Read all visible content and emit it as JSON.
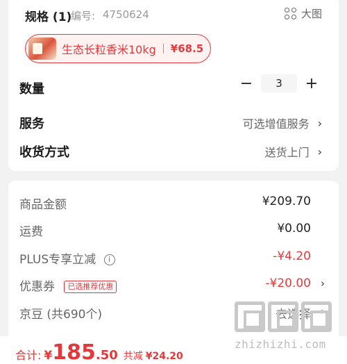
{
  "spec": {
    "title": "规格 (1)",
    "code_label": "编号:",
    "code_value": "4750624",
    "big_pic_label": "大图",
    "chip_name": "生态长粒香米10kg",
    "chip_price": "¥68.5"
  },
  "rows": {
    "quantity_label": "数量",
    "quantity_value": "3",
    "minus": "−",
    "plus": "+",
    "service_label": "服务",
    "service_value": "可选增值服务",
    "delivery_label": "收货方式",
    "delivery_value": "送货上门",
    "chevron": "›"
  },
  "price": {
    "goods_label": "商品金额",
    "goods_value": "¥209.70",
    "shipping_label": "运费",
    "shipping_value": "¥0.00",
    "plus_label": "PLUS专享立减",
    "plus_value": "-¥4.20",
    "coupon_label": "优惠券",
    "coupon_badge": "已选推荐优惠",
    "coupon_value": "-¥20.00",
    "jd_label": "京豆 (共690个)",
    "jd_value": "去选择"
  },
  "footer": {
    "total_label": "合计:",
    "yen": "¥",
    "total_int": "185",
    "total_dec": ".50",
    "saved_label": "共减",
    "saved_value": "¥24.20"
  },
  "watermark": {
    "text": "zhizhizhi.com"
  },
  "colors": {
    "accent": "#e4393c",
    "background": "#f2f2f2",
    "card": "#ffffff"
  },
  "icons": {
    "big_pic": "grid-four-circles-icon",
    "info": "info-icon",
    "chevron": "chevron-right-icon"
  }
}
